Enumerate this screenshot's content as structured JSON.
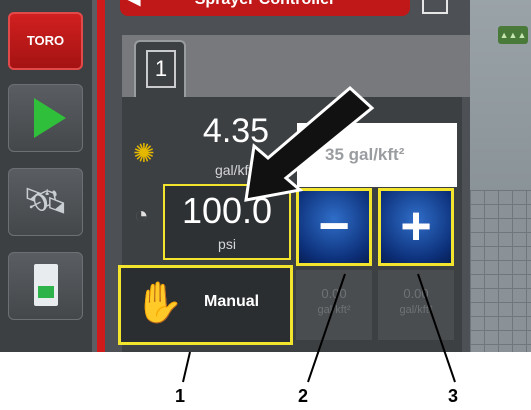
{
  "window": {
    "title": "Sprayer Controller"
  },
  "sidebar": {
    "brand": "TORO",
    "items": [
      {
        "icon": "play-icon"
      },
      {
        "icon": "satellite-icon"
      },
      {
        "icon": "document-icon"
      }
    ]
  },
  "tabs": [
    {
      "label": "1"
    }
  ],
  "rate": {
    "value": "4.35",
    "unit": "gal/kft²",
    "icon": "spray-rate-icon"
  },
  "target_rate": {
    "value": "35 gal/kft²"
  },
  "pressure": {
    "value": "100.0",
    "unit": "psi",
    "icon": "pressure-gauge-icon"
  },
  "controls": {
    "decrease_glyph": "−",
    "increase_glyph": "+",
    "mode_label": "Manual"
  },
  "presets": [
    {
      "value": "0.00",
      "unit": "gal/kft²"
    },
    {
      "value": "0.00",
      "unit": "gal/kft²"
    }
  ],
  "callouts": {
    "labels": [
      "1",
      "2",
      "3"
    ]
  },
  "colors": {
    "accent_red": "#d11a1a",
    "highlight_yellow": "#f3e42e",
    "button_blue": "#1a4fa3",
    "play_green": "#2fbf3a"
  }
}
